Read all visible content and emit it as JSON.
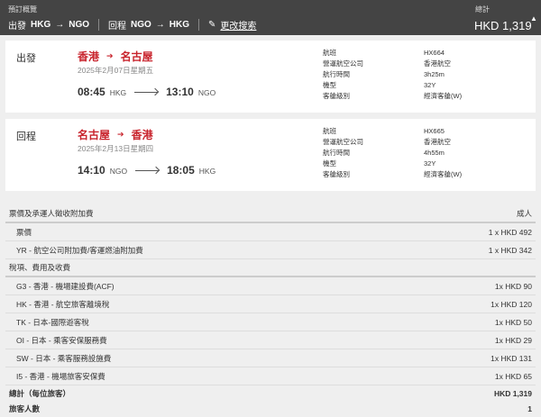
{
  "header": {
    "title": "預訂概覽",
    "outbound_label": "出發",
    "outbound_route": [
      "HKG",
      "NGO"
    ],
    "return_label": "回程",
    "return_route": [
      "NGO",
      "HKG"
    ],
    "edit_label": "更改搜索",
    "total_label": "總計",
    "total": "HKD 1,319"
  },
  "flights": [
    {
      "label": "出發",
      "from": "香港",
      "to": "名古屋",
      "date": "2025年2月07日星期五",
      "dep_time": "08:45",
      "dep_code": "HKG",
      "arr_time": "13:10",
      "arr_code": "NGO",
      "details": [
        [
          "航班",
          "HX664"
        ],
        [
          "營運航空公司",
          "香港航空"
        ],
        [
          "航行時間",
          "3h25m"
        ],
        [
          "機型",
          "32Y"
        ],
        [
          "客艙級別",
          "經濟客艙(W)"
        ]
      ]
    },
    {
      "label": "回程",
      "from": "名古屋",
      "to": "香港",
      "date": "2025年2月13日星期四",
      "dep_time": "14:10",
      "dep_code": "NGO",
      "arr_time": "18:05",
      "arr_code": "HKG",
      "details": [
        [
          "航班",
          "HX665"
        ],
        [
          "營運航空公司",
          "香港航空"
        ],
        [
          "航行時間",
          "4h55m"
        ],
        [
          "機型",
          "32Y"
        ],
        [
          "客艙級別",
          "經濟客艙(W)"
        ]
      ]
    }
  ],
  "fare": {
    "section1": "票價及承運人徵收附加費",
    "pax_type": "成人",
    "items1": [
      [
        "票價",
        "1 x HKD 492"
      ],
      [
        "YR - 航空公司附加費/客運燃油附加費",
        "1 x HKD 342"
      ]
    ],
    "section2": "稅項、費用及收費",
    "items2": [
      [
        "G3 - 香港 - 機場建設費(ACF)",
        "1x HKD 90"
      ],
      [
        "HK - 香港 - 航空旅客離境稅",
        "1x HKD 120"
      ],
      [
        "TK - 日本-國際遊客稅",
        "1x HKD 50"
      ],
      [
        "OI - 日本 - 乘客安保服務費",
        "1x HKD 29"
      ],
      [
        "SW - 日本 - 乘客服務設施費",
        "1x HKD 131"
      ],
      [
        "I5 - 香港 - 機場旅客安保費",
        "1x HKD 65"
      ]
    ],
    "total_label": "總計（每位旅客）",
    "total": "HKD 1,319",
    "pax_label": "旅客人數",
    "pax_count": "1"
  },
  "colors": {
    "header_bg": "#444444",
    "accent": "#c8232c"
  }
}
